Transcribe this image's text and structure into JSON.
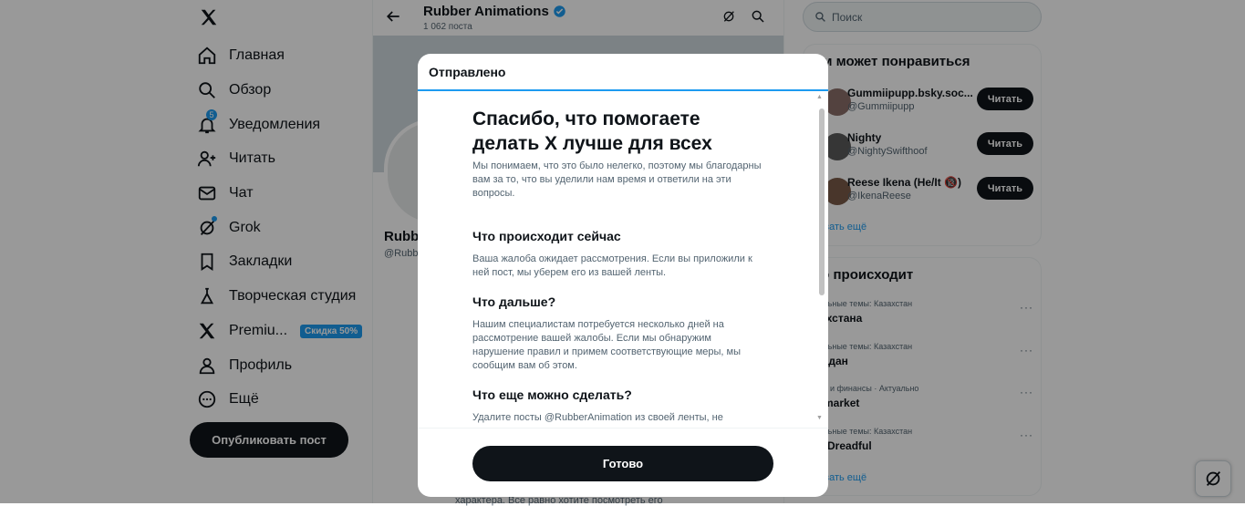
{
  "nav": {
    "items": [
      {
        "label": "Главная",
        "icon": "home-icon"
      },
      {
        "label": "Обзор",
        "icon": "search-icon"
      },
      {
        "label": "Уведомления",
        "icon": "bell-icon",
        "badge": "5"
      },
      {
        "label": "Читать",
        "icon": "person-add-icon"
      },
      {
        "label": "Чат",
        "icon": "envelope-icon"
      },
      {
        "label": "Grok",
        "icon": "grok-icon"
      },
      {
        "label": "Закладки",
        "icon": "bookmark-icon"
      },
      {
        "label": "Творческая студия",
        "icon": "flask-icon"
      },
      {
        "label": "Premiu...",
        "icon": "x-icon",
        "badge": "Скидка 50%"
      },
      {
        "label": "Профиль",
        "icon": "person-icon"
      },
      {
        "label": "Ещё",
        "icon": "more-circle-icon"
      }
    ],
    "post_button": "Опубликовать пост"
  },
  "header": {
    "name": "Rubber Animations",
    "post_count": "1 062 поста"
  },
  "profile": {
    "name_partial": "Rubb",
    "handle_partial": "@Rubb",
    "below_text": "характера. Все равно хотите посмотреть его"
  },
  "search": {
    "placeholder": "Поиск"
  },
  "who_to_follow": {
    "title": "ам может понравиться",
    "users": [
      {
        "name": "Gummiipupp.bsky.soc...",
        "handle": "@Gummiipupp",
        "button": "Читать"
      },
      {
        "name": "Nighty",
        "handle": "@NightySwifthoof",
        "button": "Читать"
      },
      {
        "name": "Reese Ikena (He/It 🔞)",
        "handle": "@IkenaReese",
        "button": "Читать"
      }
    ],
    "show_more": "казать ещё"
  },
  "trends": {
    "title": "то происходит",
    "items": [
      {
        "category": "уальные темы: Казахстан",
        "name": "азхстана"
      },
      {
        "category": "уальные темы: Казахстан",
        "name": "мадан"
      },
      {
        "category": "нес и финансы · Актуально",
        "name": "lymarket"
      },
      {
        "category": "уальные темы: Казахстан",
        "name": "heDreadful"
      }
    ],
    "show_more": "казать ещё"
  },
  "modal": {
    "title": "Отправлено",
    "heading": "Спасибо, что помогаете делать X лучше для всех",
    "subtitle": "Мы понимаем, что это было нелегко, поэтому мы благодарны вам за то, что вы уделили нам время и ответили на эти вопросы.",
    "sections": [
      {
        "title": "Что происходит сейчас",
        "text": "Ваша жалоба ожидает рассмотрения. Если вы приложили к ней пост, мы уберем его из вашей ленты."
      },
      {
        "title": "Что дальше?",
        "text": "Нашим специалистам потребуется несколько дней на рассмотрение вашей жалобы. Если мы обнаружим нарушение правил и примем соответствующие меры, мы сообщим вам об этом."
      },
      {
        "title": "Что еще можно сделать?",
        "text": "Удалите посты @RubberAnimation из своей ленты, не"
      }
    ],
    "done_button": "Готово"
  },
  "colors": {
    "accent": "#1d9bf0",
    "dark": "#0f1419",
    "muted": "#536471"
  }
}
